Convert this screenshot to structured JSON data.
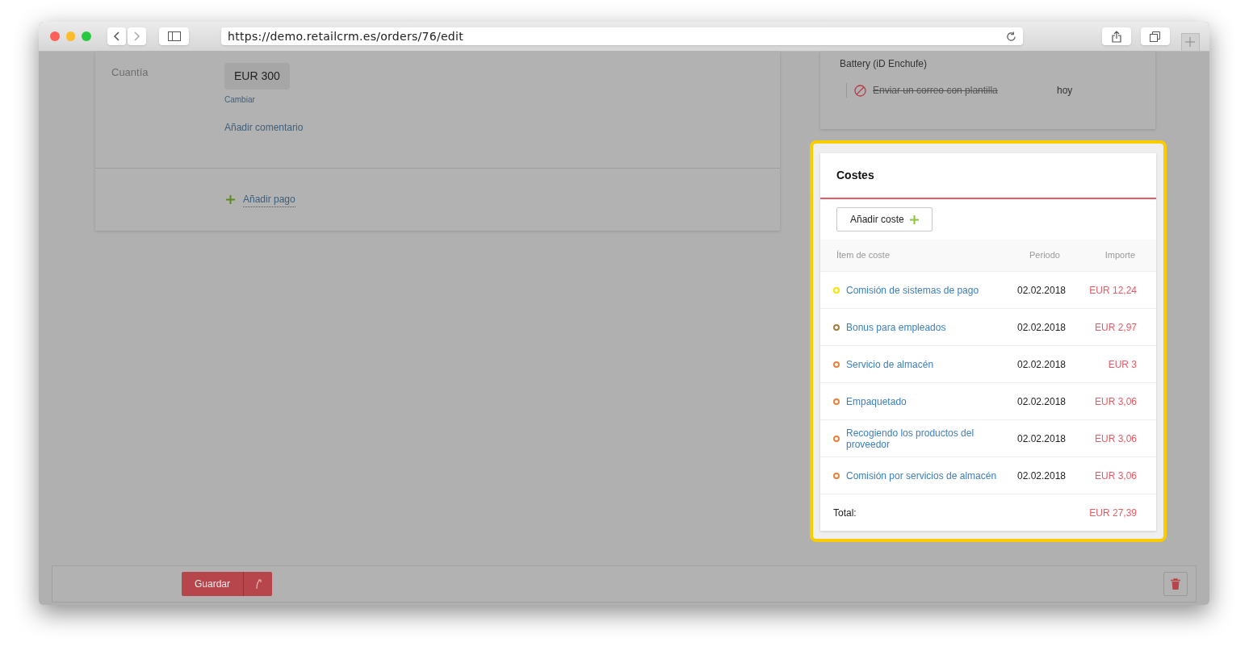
{
  "browser": {
    "url": "https://demo.retailcrm.es/orders/76/edit"
  },
  "payment": {
    "label": "Cuantía",
    "amount": "EUR 300",
    "change_link": "Cambiar",
    "comment_link": "Añadir comentario",
    "add_payment": "Añadir pago"
  },
  "task_card": {
    "title": "Battery (iD Enchufe)",
    "task": {
      "text": "Enviar un correo con plantilla",
      "cancelled": true,
      "due": "hoy"
    }
  },
  "costs": {
    "title": "Costes",
    "add_button": "Añadir coste",
    "columns": [
      "Ítem de coste",
      "Periodo",
      "Importe"
    ],
    "rows": [
      {
        "item": "Comisión de sistemas de pago",
        "period": "02.02.2018",
        "amount": "EUR 12,24",
        "color": "#f5e600"
      },
      {
        "item": "Bonus para empleados",
        "period": "02.02.2018",
        "amount": "EUR 2,97",
        "color": "#a57d3c"
      },
      {
        "item": "Servicio de almacén",
        "period": "02.02.2018",
        "amount": "EUR 3",
        "color": "#e8803e"
      },
      {
        "item": "Empaquetado",
        "period": "02.02.2018",
        "amount": "EUR 3,06",
        "color": "#e8803e"
      },
      {
        "item": "Recogiendo los productos del proveedor",
        "period": "02.02.2018",
        "amount": "EUR 3,06",
        "color": "#e8803e"
      },
      {
        "item": "Comisión por servicios de almacén",
        "period": "02.02.2018",
        "amount": "EUR 3,06",
        "color": "#e8803e"
      }
    ],
    "total_label": "Total:",
    "total_amount": "EUR 27,39"
  },
  "footer": {
    "save_button": "Guardar"
  }
}
